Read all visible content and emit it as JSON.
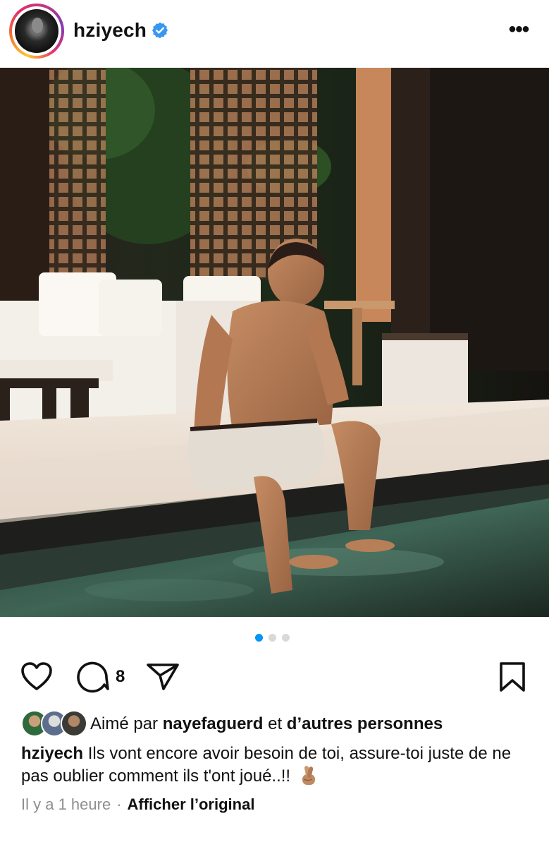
{
  "post": {
    "username": "hziyech",
    "more_label": "•••",
    "comment_count": "8",
    "likes": {
      "prefix": "Aimé par",
      "liker": "nayefaguerd",
      "conjunction": "et",
      "others": "d’autres personnes"
    },
    "caption": {
      "username": "hziyech",
      "text": "Ils vont encore avoir besoin de toi, assure-toi juste de ne pas oublier comment ils t'ont joué..!!"
    },
    "meta": {
      "time": "Il y a 1 heure",
      "separator": "·",
      "translate_label": "Afficher l’original"
    },
    "carousel": {
      "total": 3,
      "active_index": 0
    }
  },
  "icons": {
    "verified": "verified-badge-icon",
    "like": "heart-icon",
    "comment": "comment-icon",
    "share": "paper-plane-icon",
    "save": "bookmark-icon",
    "emoji": "crossed-fingers-emoji"
  },
  "colors": {
    "verified_blue": "#3897f0",
    "active_dot": "#0095f6",
    "inactive_dot": "#d9d9d9",
    "meta_gray": "#8e8e8e"
  }
}
